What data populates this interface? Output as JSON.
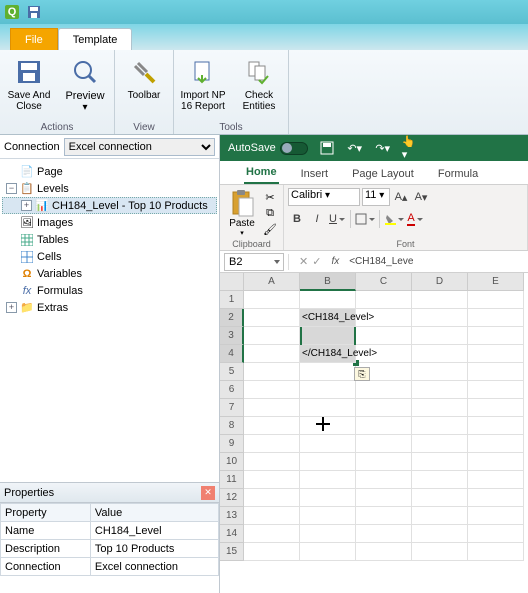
{
  "titlebar": {
    "app_icon": "Q"
  },
  "tabs": {
    "file": "File",
    "template": "Template"
  },
  "ribbon": {
    "actions": {
      "title": "Actions",
      "save_close": "Save And\nClose",
      "preview": "Preview"
    },
    "view": {
      "title": "View",
      "toolbar": "Toolbar"
    },
    "tools": {
      "title": "Tools",
      "import": "Import NP\n16 Report",
      "check": "Check\nEntities"
    }
  },
  "connection": {
    "label": "Connection",
    "value": "Excel connection"
  },
  "tree": {
    "page": "Page",
    "levels": "Levels",
    "level_item": "CH184_Level - Top 10 Products",
    "images": "Images",
    "tables": "Tables",
    "cells": "Cells",
    "variables": "Variables",
    "formulas": "Formulas",
    "extras": "Extras"
  },
  "props": {
    "title": "Properties",
    "cols": {
      "property": "Property",
      "value": "Value"
    },
    "rows": [
      {
        "p": "Name",
        "v": "CH184_Level"
      },
      {
        "p": "Description",
        "v": "Top 10 Products"
      },
      {
        "p": "Connection",
        "v": "Excel connection"
      }
    ]
  },
  "excel": {
    "autosave": "AutoSave",
    "tabs": {
      "home": "Home",
      "insert": "Insert",
      "pagelayout": "Page Layout",
      "formula": "Formula"
    },
    "clipboard": {
      "title": "Clipboard",
      "paste": "Paste"
    },
    "font": {
      "title": "Font",
      "name": "Calibri",
      "size": "11",
      "bold": "B",
      "italic": "I",
      "underline": "U"
    },
    "namebox": "B2",
    "formula_value": "<CH184_Leve",
    "cols": [
      "A",
      "B",
      "C",
      "D",
      "E"
    ],
    "rows": [
      "1",
      "2",
      "3",
      "4",
      "5",
      "6",
      "7",
      "8",
      "9",
      "10",
      "11",
      "12",
      "13",
      "14",
      "15"
    ],
    "cell_b2": "<CH184_Level>",
    "cell_b4": "</CH184_Level>"
  }
}
